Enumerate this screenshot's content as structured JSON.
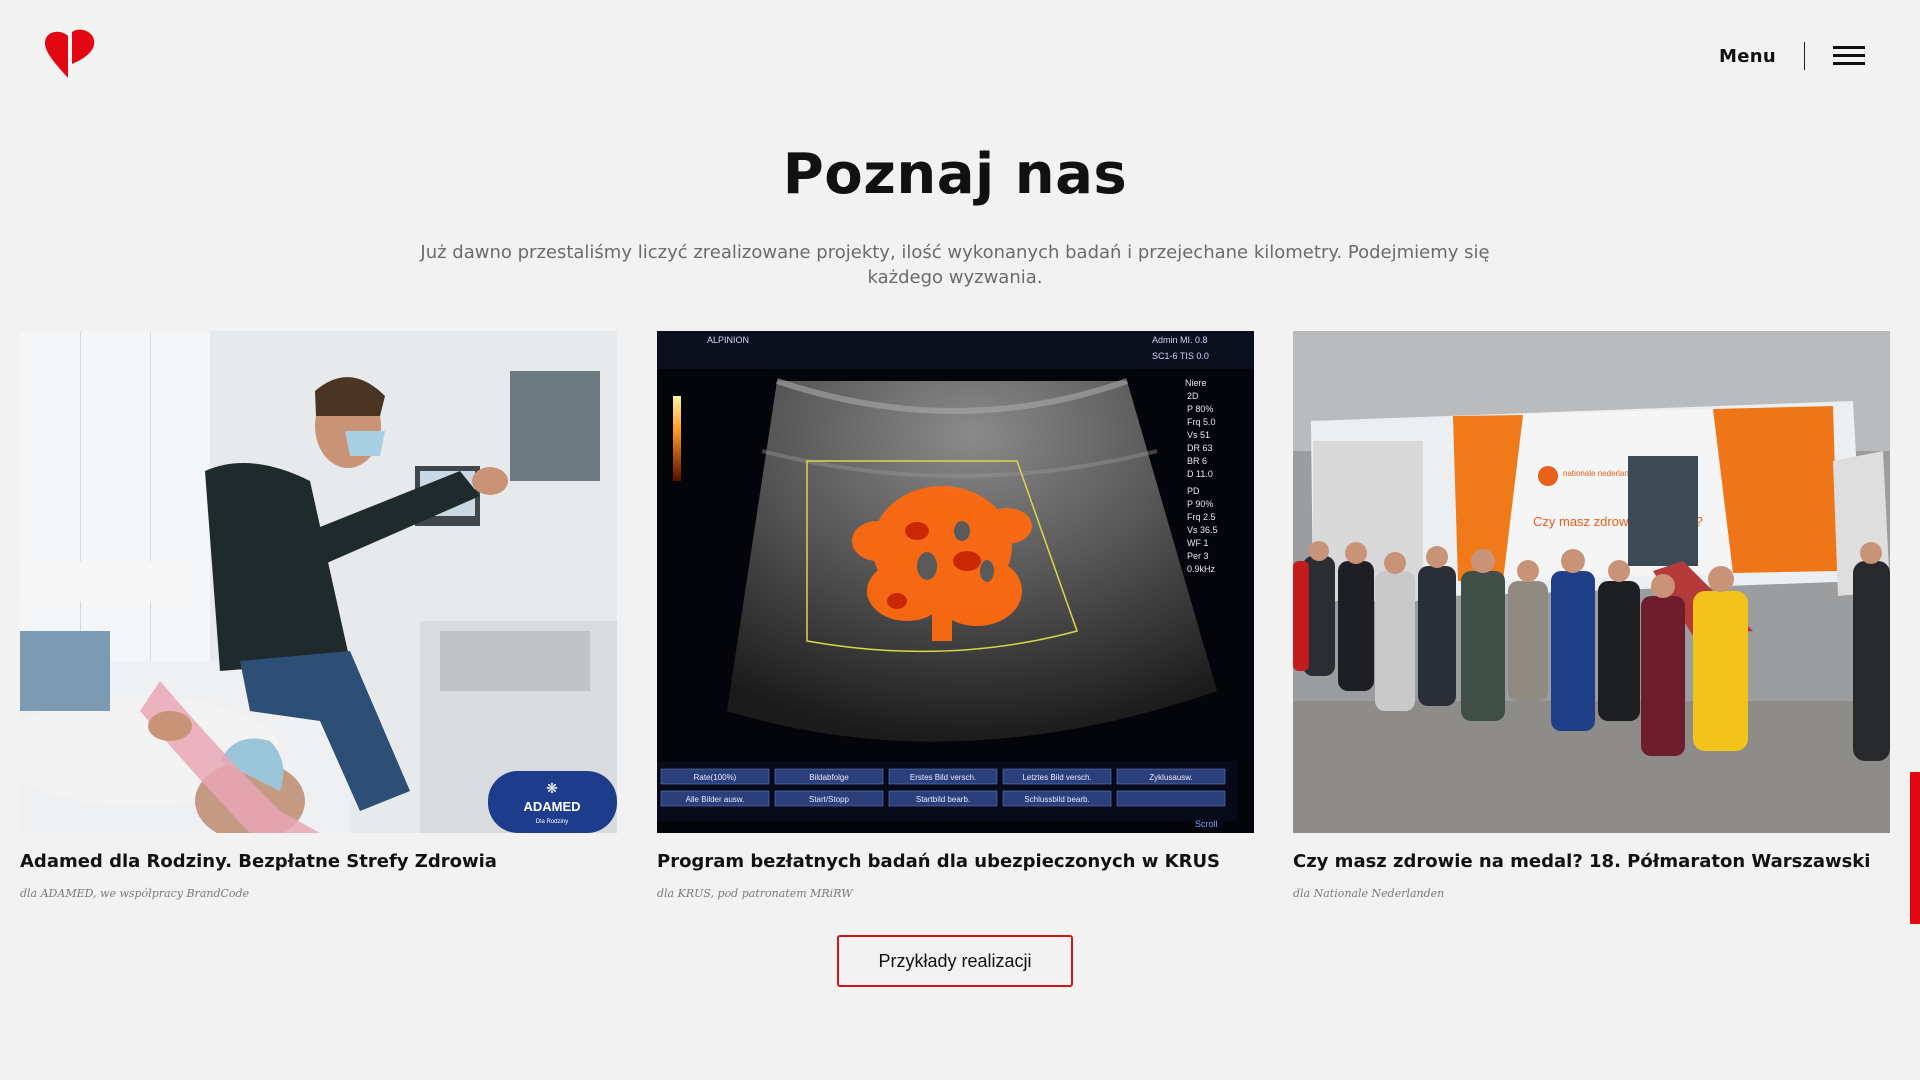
{
  "header": {
    "menu_label": "Menu"
  },
  "section": {
    "title": "Poznaj nas",
    "intro": "Już dawno przestaliśmy liczyć zrealizowane projekty, ilość wykonanych badań i przejechane kilometry. Podejmiemy się każdego wyzwania."
  },
  "cards": [
    {
      "title": "Adamed dla Rodziny. Bezpłatne Strefy Zdrowia",
      "subtitle": "dla ADAMED, we współpracy BrandCode",
      "badge": "ADAMED",
      "badge_sub": "Dla Rodziny"
    },
    {
      "title": "Program bezłatnych badań dla ubezpieczonych w KRUS",
      "subtitle": "dla KRUS, pod patronatem MRiRW",
      "screen": {
        "brand": "ALPINION",
        "top_right_1": "Admin  MI. 0.8",
        "top_right_2": "SC1-6  TIS 0.0",
        "readout": [
          "Niere",
          "2D",
          "P 80%",
          "Frq 5.0",
          "Vs 51",
          "DR 63",
          "BR 6",
          "D 11.0",
          "PD",
          "P 90%",
          "Frq 2.5",
          "Vs 36.5",
          "WF 1",
          "Per 3",
          "0.9kHz"
        ],
        "softkeys_row1": [
          "Rate(100%)",
          "Bildabfolge",
          "Erstes Bild versch.",
          "Letztes Bild versch.",
          "Zyklusausw."
        ],
        "softkeys_row2": [
          "Alle Bilder ausw.",
          "Start/Stopp",
          "Startbild bearb.",
          "Schlussbild bearb.",
          ""
        ],
        "scroll_label": "Scroll"
      }
    },
    {
      "title": "Czy masz zdrowie na medal? 18. Półmaraton Warszawski",
      "subtitle": "dla Nationale Nederlanden",
      "truck_brand": "nationale nederlanden",
      "truck_slogan": "Czy masz zdrowie na medal?"
    }
  ],
  "cta_label": "Przykłady realizacji",
  "colors": {
    "brand_red": "#e30613",
    "background": "#f2f2f2",
    "text": "#111111",
    "muted": "#6b6b6b"
  }
}
